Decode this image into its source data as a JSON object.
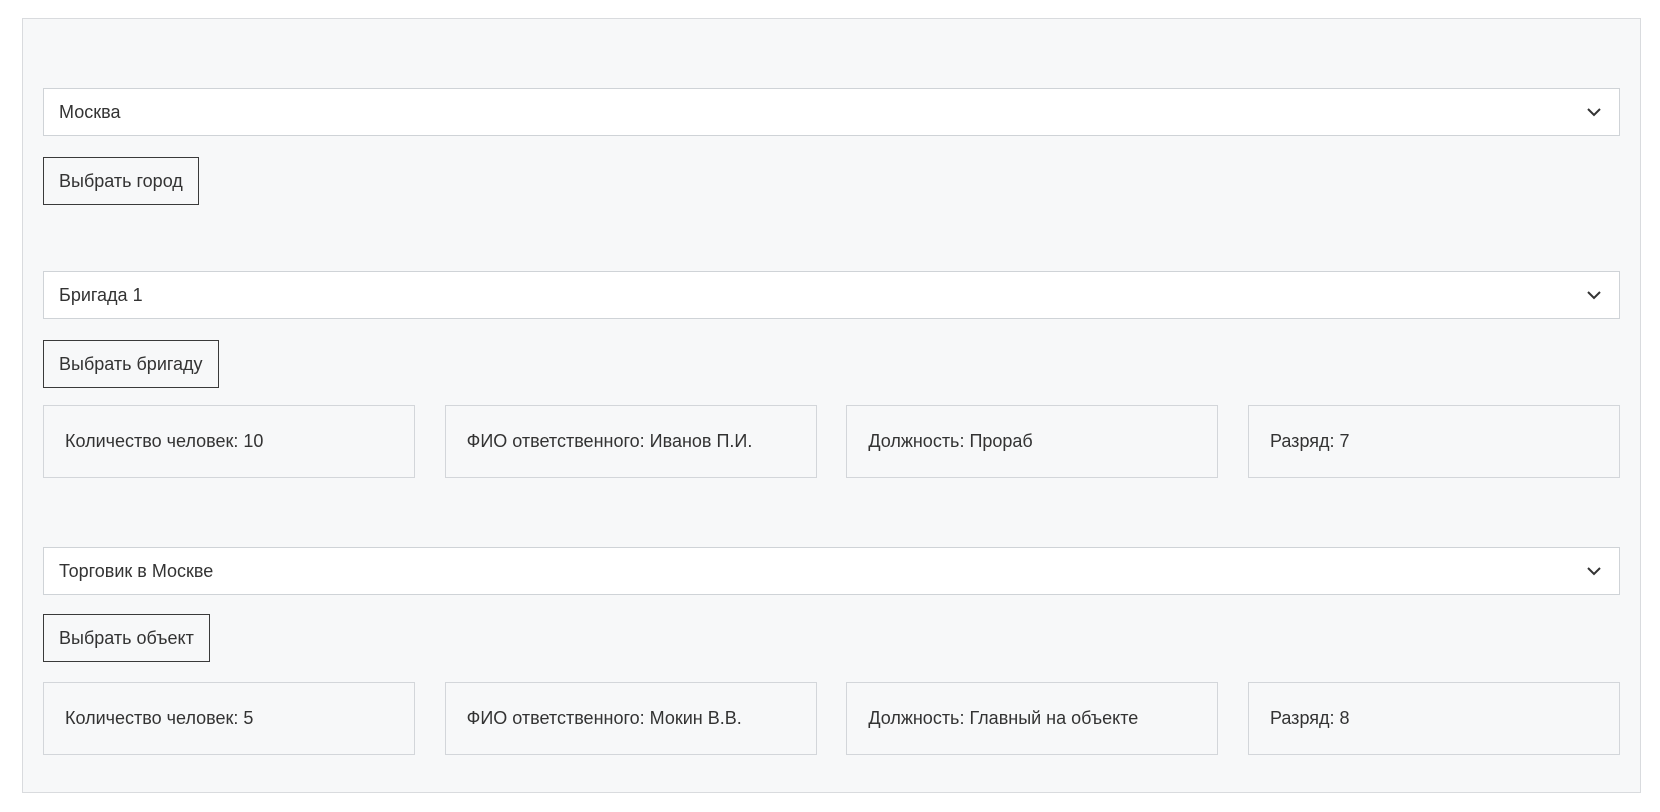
{
  "city": {
    "select_value": "Москва",
    "button_label": "Выбрать город"
  },
  "brigade": {
    "select_value": "Бригада 1",
    "button_label": "Выбрать бригаду",
    "cards": [
      "Количество человек: 10",
      "ФИО ответственного: Иванов П.И.",
      "Должность: Прораб",
      "Разряд: 7"
    ]
  },
  "object": {
    "select_value": "Торговик в Москве",
    "button_label": "Выбрать объект",
    "cards": [
      "Количество человек: 5",
      "ФИО ответственного: Мокин В.В.",
      "Должность: Главный на объекте",
      "Разряд: 8"
    ]
  }
}
